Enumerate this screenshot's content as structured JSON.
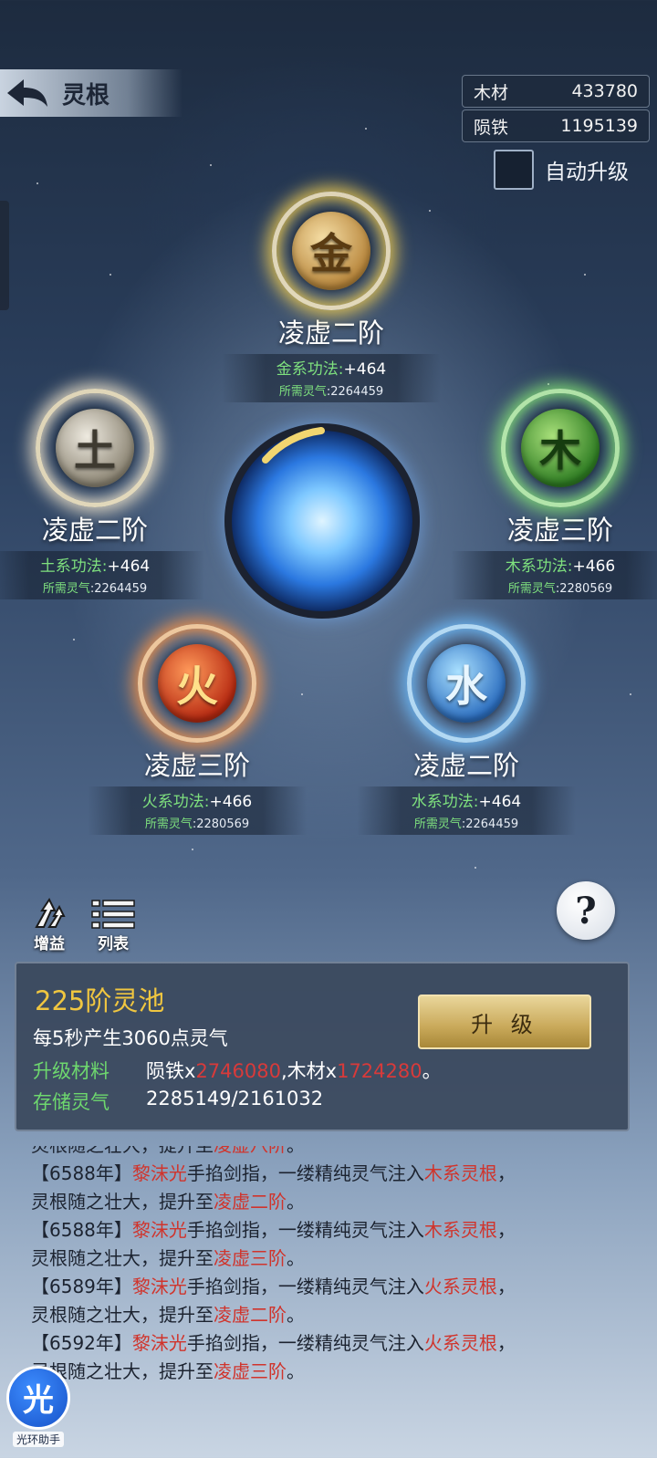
{
  "header": {
    "title": "灵根"
  },
  "resources": {
    "wood_label": "木材",
    "wood_value": "433780",
    "iron_label": "陨铁",
    "iron_value": "1195139"
  },
  "auto_upgrade": {
    "label": "自动升级",
    "checked": false
  },
  "roots": {
    "metal": {
      "glyph": "金",
      "level": "凌虚二阶",
      "stat_key": "金系功法:",
      "stat_val": "+464",
      "need_key": "所需灵气",
      "need_val": ":2264459"
    },
    "earth": {
      "glyph": "土",
      "level": "凌虚二阶",
      "stat_key": "土系功法:",
      "stat_val": "+464",
      "need_key": "所需灵气",
      "need_val": ":2264459"
    },
    "wood": {
      "glyph": "木",
      "level": "凌虚三阶",
      "stat_key": "木系功法:",
      "stat_val": "+466",
      "need_key": "所需灵气",
      "need_val": ":2280569"
    },
    "fire": {
      "glyph": "火",
      "level": "凌虚三阶",
      "stat_key": "火系功法:",
      "stat_val": "+466",
      "need_key": "所需灵气",
      "need_val": ":2280569"
    },
    "water": {
      "glyph": "水",
      "level": "凌虚二阶",
      "stat_key": "水系功法:",
      "stat_val": "+464",
      "need_key": "所需灵气",
      "need_val": ":2264459"
    }
  },
  "tools": {
    "buff_label": "增益",
    "list_label": "列表",
    "help_glyph": "?"
  },
  "pool": {
    "title": "225阶灵池",
    "rate": "每5秒产生3060点灵气",
    "material_key": "升级材料",
    "material_iron": "陨铁x",
    "material_iron_amount": "2746080",
    "material_wood": ",木材x",
    "material_wood_amount": "1724280",
    "material_end": "。",
    "storage_key": "存储灵气",
    "storage_value": "2285149/2161032",
    "upgrade_label": "升 级"
  },
  "log": [
    {
      "a": "灵根随之壮大，提升至",
      "b": "",
      "c": "",
      "d": "",
      "e": "",
      "f": "",
      "g": "凌虚八阶",
      "h": "。"
    },
    {
      "a": "【6588年】",
      "b": "黎沫光",
      "c": "手掐剑指，一缕精纯灵气注入",
      "d": "木系灵根",
      "e": "，",
      "f": "灵根随之壮大，提升至",
      "g": "凌虚二阶",
      "h": "。"
    },
    {
      "a": "【6588年】",
      "b": "黎沫光",
      "c": "手掐剑指，一缕精纯灵气注入",
      "d": "木系灵根",
      "e": "，",
      "f": "灵根随之壮大，提升至",
      "g": "凌虚三阶",
      "h": "。"
    },
    {
      "a": "【6589年】",
      "b": "黎沫光",
      "c": "手掐剑指，一缕精纯灵气注入",
      "d": "火系灵根",
      "e": "，",
      "f": "灵根随之壮大，提升至",
      "g": "凌虚二阶",
      "h": "。"
    },
    {
      "a": "【6592年】",
      "b": "黎沫光",
      "c": "手掐剑指，一缕精纯灵气注入",
      "d": "火系灵根",
      "e": "，",
      "f": "灵根随之壮大，提升至",
      "g": "凌虚三阶",
      "h": "。"
    }
  ],
  "assistant": {
    "glyph": "光",
    "label": "光环助手"
  }
}
